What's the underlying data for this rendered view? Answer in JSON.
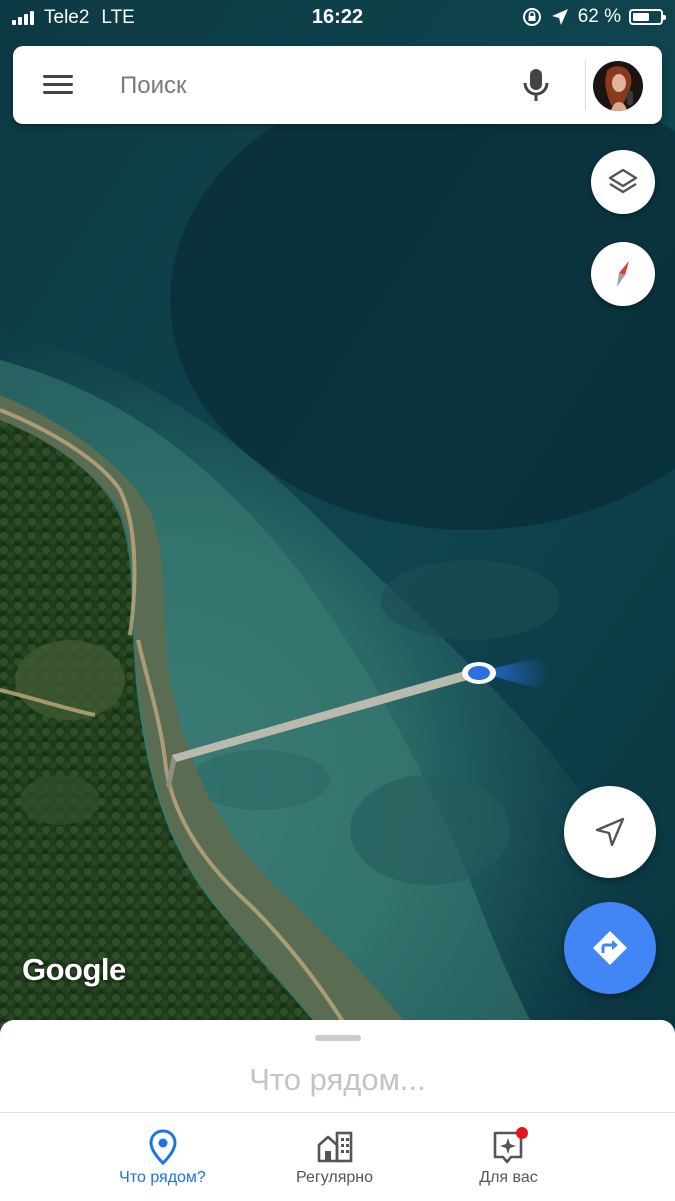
{
  "status_bar": {
    "carrier": "Tele2",
    "network": "LTE",
    "time": "16:22",
    "battery": "62 %",
    "battery_level": 0.62,
    "signal_bars": 4,
    "icons": [
      "rotation-lock-icon",
      "location-arrow-icon"
    ]
  },
  "search": {
    "placeholder": "Поиск",
    "icons": [
      "menu-icon",
      "microphone-icon",
      "avatar"
    ]
  },
  "map": {
    "type": "satellite",
    "watermark": "Google",
    "location_marker": "blue-dot-with-heading",
    "colors": {
      "deep_water": "#0f3f4d",
      "shallow_water": "#2d7068",
      "forest": "#1f3d1c",
      "marker": "#2a70e3"
    }
  },
  "controls": {
    "layers": "layers-icon",
    "compass": "compass-icon",
    "my_location": "navigation-arrow-icon",
    "directions": "directions-icon",
    "directions_color": "#4285f4"
  },
  "sheet": {
    "title": "Что рядом..."
  },
  "bottom_nav": {
    "items": [
      {
        "label": "Что рядом?",
        "icon": "place-pin-icon",
        "active": true,
        "color": "#1a73e8"
      },
      {
        "label": "Регулярно",
        "icon": "commute-buildings-icon",
        "active": false,
        "color": "#555555"
      },
      {
        "label": "Для вас",
        "icon": "for-you-sparkle-icon",
        "active": false,
        "color": "#555555",
        "badge": true
      }
    ]
  }
}
